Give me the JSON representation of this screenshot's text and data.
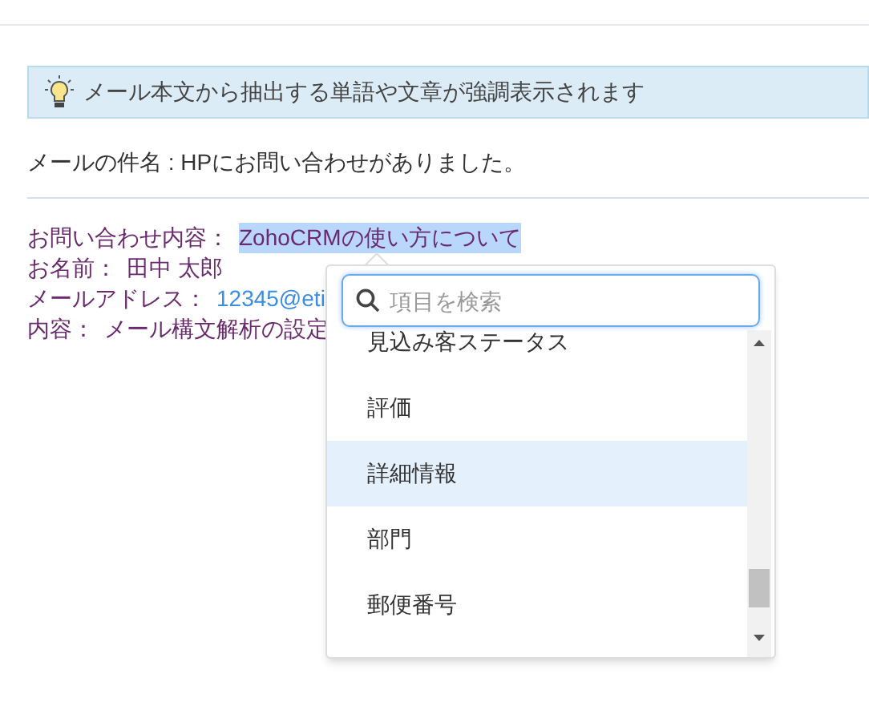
{
  "banner": {
    "text": "メール本文から抽出する単語や文章が強調表示されます"
  },
  "subject": "メールの件名 : HPにお問い合わせがありました。",
  "body_lines": [
    {
      "label": "お問い合わせ内容：",
      "value": "ZohoCRMの使い方について",
      "kind": "highlighted"
    },
    {
      "label": "お名前：",
      "value": "田中 太郎",
      "kind": "plain"
    },
    {
      "label": "メールアドレス：",
      "value": "12345@eti",
      "kind": "link"
    },
    {
      "label": "内容：",
      "value": "メール構文解析の設定",
      "kind": "plain"
    }
  ],
  "dropdown": {
    "search": {
      "placeholder": "項目を検索"
    },
    "items": [
      {
        "label": "見込み客ステータス",
        "selected": false
      },
      {
        "label": "評価",
        "selected": false
      },
      {
        "label": "詳細情報",
        "selected": true
      },
      {
        "label": "部門",
        "selected": false
      },
      {
        "label": "郵便番号",
        "selected": false
      }
    ]
  }
}
